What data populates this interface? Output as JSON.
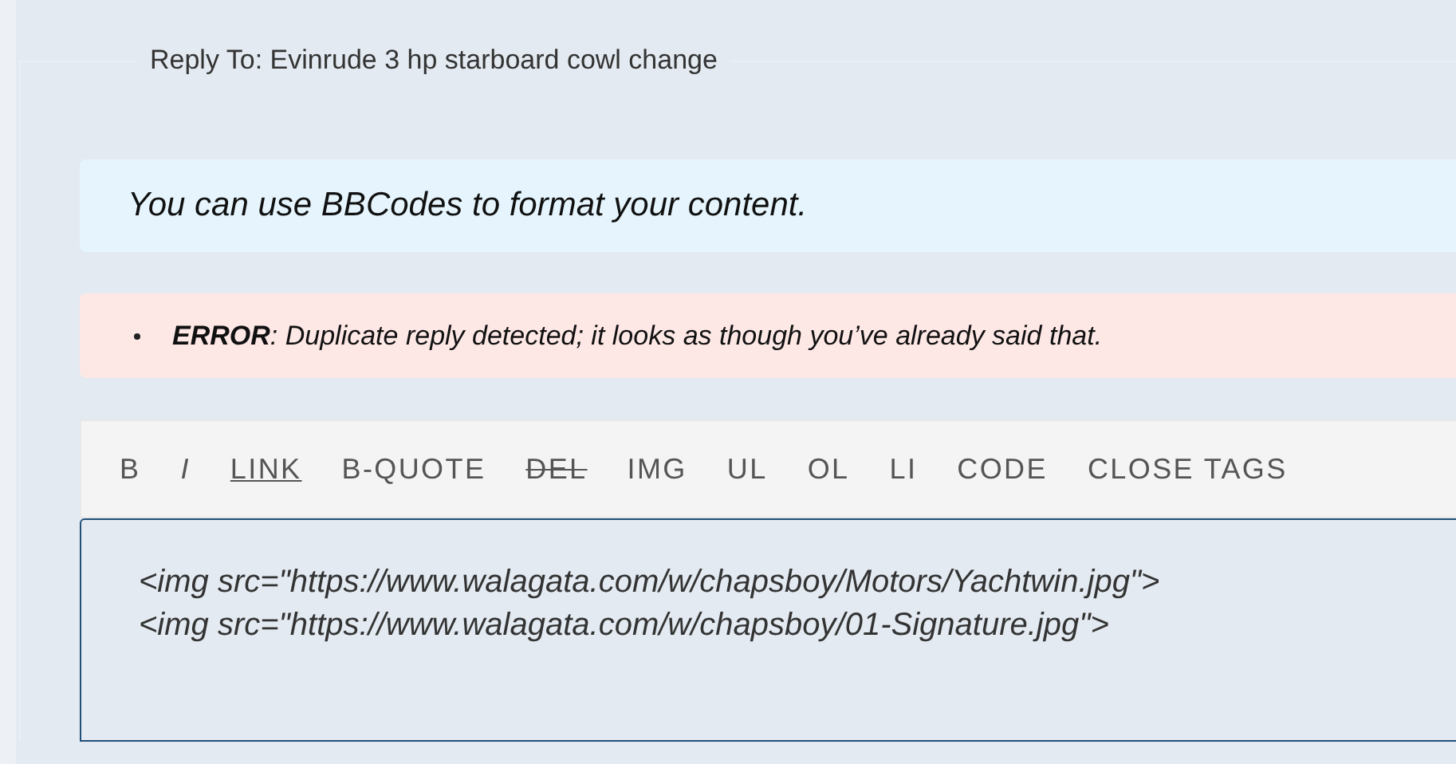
{
  "form": {
    "legend": "Reply To: Evinrude 3 hp starboard cowl change"
  },
  "info_notice": "You can use BBCodes to format your content.",
  "errors": [
    "**ERROR**: Duplicate reply detected; it looks as though you’ve already said that."
  ],
  "toolbar": [
    {
      "label": "B",
      "kind": "plain"
    },
    {
      "label": "I",
      "kind": "italic"
    },
    {
      "label": "LINK",
      "kind": "underline"
    },
    {
      "label": "B-QUOTE",
      "kind": "plain"
    },
    {
      "label": "DEL",
      "kind": "strike"
    },
    {
      "label": "IMG",
      "kind": "plain"
    },
    {
      "label": "UL",
      "kind": "plain"
    },
    {
      "label": "OL",
      "kind": "plain"
    },
    {
      "label": "LI",
      "kind": "plain"
    },
    {
      "label": "CODE",
      "kind": "plain"
    },
    {
      "label": "CLOSE TAGS",
      "kind": "plain"
    }
  ],
  "editor": {
    "value": "<img src=\"https://www.walagata.com/w/chapsboy/Motors/Yachtwin.jpg\">\n<img src=\"https://www.walagata.com/w/chapsboy/01-Signature.jpg\">"
  }
}
